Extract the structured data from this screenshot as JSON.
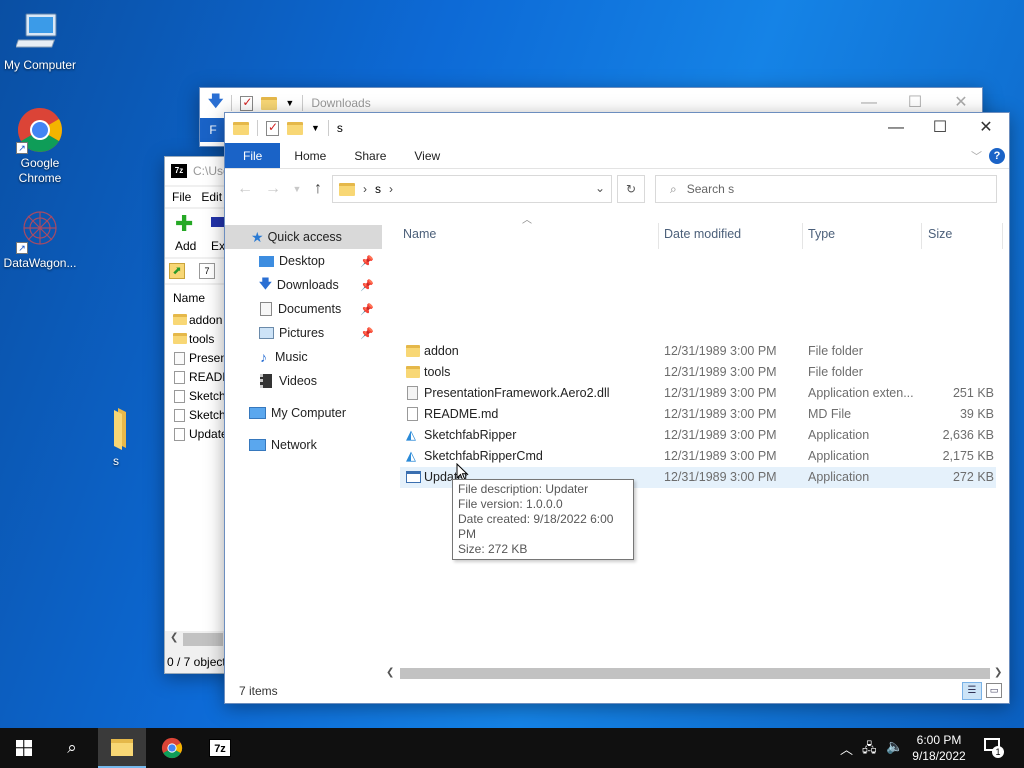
{
  "desktop": {
    "icons": [
      {
        "label": "My Computer"
      },
      {
        "label": "Google Chrome"
      },
      {
        "label": "DataWagon..."
      },
      {
        "label": "s"
      }
    ]
  },
  "back_window": {
    "title": "Downloads",
    "tab_file": "F"
  },
  "zip_window": {
    "title": "C:\\Use",
    "menu": [
      "File",
      "Edit"
    ],
    "toolbar": {
      "add_label": "Add",
      "extract_label": "Ext"
    },
    "column_name": "Name",
    "items": [
      "addon",
      "tools",
      "Presen",
      "READM",
      "Sketch",
      "Sketch",
      "Update"
    ],
    "status": "0 / 7 object"
  },
  "explorer": {
    "title": "s",
    "tabs": {
      "file": "File",
      "home": "Home",
      "share": "Share",
      "view": "View"
    },
    "address": {
      "crumb": "s"
    },
    "search_placeholder": "Search s",
    "nav": {
      "quick_access": "Quick access",
      "desktop": "Desktop",
      "downloads": "Downloads",
      "documents": "Documents",
      "pictures": "Pictures",
      "music": "Music",
      "videos": "Videos",
      "my_computer": "My Computer",
      "network": "Network"
    },
    "columns": {
      "name": "Name",
      "date": "Date modified",
      "type": "Type",
      "size": "Size"
    },
    "files": [
      {
        "name": "addon",
        "date": "12/31/1989 3:00 PM",
        "type": "File folder",
        "size": "",
        "icon": "folder-icon"
      },
      {
        "name": "tools",
        "date": "12/31/1989 3:00 PM",
        "type": "File folder",
        "size": "",
        "icon": "folder-icon"
      },
      {
        "name": "PresentationFramework.Aero2.dll",
        "date": "12/31/1989 3:00 PM",
        "type": "Application exten...",
        "size": "251 KB",
        "icon": "dll-icon"
      },
      {
        "name": "README.md",
        "date": "12/31/1989 3:00 PM",
        "type": "MD File",
        "size": "39 KB",
        "icon": "document-icon"
      },
      {
        "name": "SketchfabRipper",
        "date": "12/31/1989 3:00 PM",
        "type": "Application",
        "size": "2,636 KB",
        "icon": "app-icon"
      },
      {
        "name": "SketchfabRipperCmd",
        "date": "12/31/1989 3:00 PM",
        "type": "Application",
        "size": "2,175 KB",
        "icon": "app-icon"
      },
      {
        "name": "Updater",
        "date": "12/31/1989 3:00 PM",
        "type": "Application",
        "size": "272 KB",
        "icon": "exe-icon"
      }
    ],
    "status": "7 items",
    "tooltip": {
      "line1": "File description: Updater",
      "line2": "File version: 1.0.0.0",
      "line3": "Date created: 9/18/2022 6:00 PM",
      "line4": "Size: 272 KB"
    }
  },
  "taskbar": {
    "time": "6:00 PM",
    "date": "9/18/2022",
    "notification_count": "1"
  }
}
